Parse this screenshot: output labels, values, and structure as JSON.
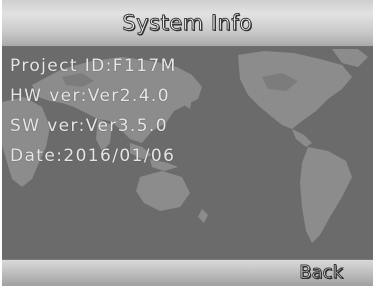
{
  "window": {
    "title": "System Info"
  },
  "info": {
    "project_id": "Project ID:F117M",
    "hw_ver": "HW ver:Ver2.4.0",
    "sw_ver": "SW ver:Ver3.5.0",
    "date": "Date:2016/01/06"
  },
  "footer": {
    "back_label": "Back"
  },
  "background": {
    "image": "world-map",
    "map_color": "#8a8a8a",
    "ocean_color": "#6b6b6b"
  }
}
